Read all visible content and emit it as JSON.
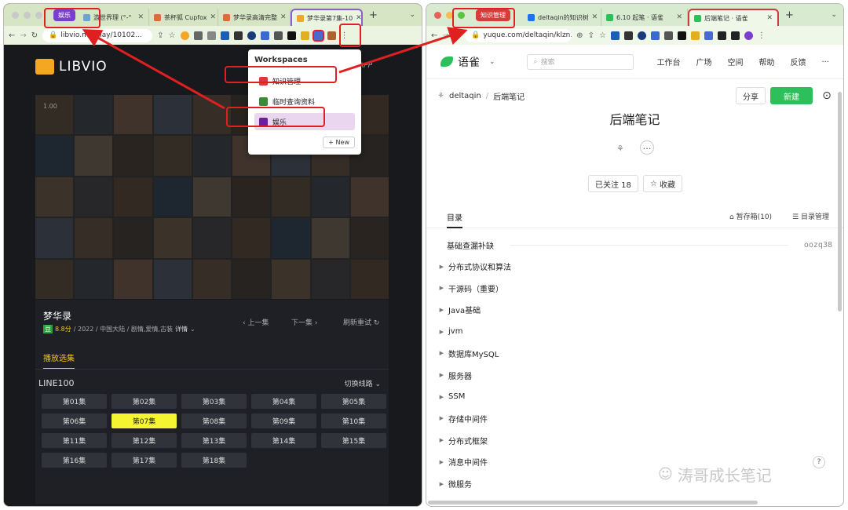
{
  "left": {
    "tabs": [
      {
        "label": "游世界理 (°-°",
        "fav": "#6aa3d8"
      },
      {
        "label": "茶杯狐 Cupfox",
        "fav": "#e06a3a"
      },
      {
        "label": "梦华录高清完整",
        "fav": "#e06a3a"
      },
      {
        "label": "梦华录第7集-10",
        "fav": "#f5a623"
      }
    ],
    "group": "娱乐",
    "url": "libvio.me/play/10102...",
    "logo": "LIBVIO",
    "app": "APP",
    "poster_label": "1.00",
    "show": {
      "title": "梦华录",
      "db": "豆",
      "score": "8.8分",
      "meta": "/ 2022 / 中国大陆 / 剧情,爱情,古装",
      "detail": "详情",
      "prev": "上一集",
      "next": "下一集",
      "refresh": "刷新重试"
    },
    "play_tab": "播放选集",
    "line": "LINE100",
    "switch": "切换线路",
    "episodes": [
      "第01集",
      "第02集",
      "第03集",
      "第04集",
      "第05集",
      "第06集",
      "第07集",
      "第08集",
      "第09集",
      "第10集",
      "第11集",
      "第12集",
      "第13集",
      "第14集",
      "第15集",
      "第16集",
      "第17集",
      "第18集"
    ],
    "current_episode": "第07集"
  },
  "workspaces": {
    "title": "Workspaces",
    "items": [
      {
        "label": "知识管理",
        "color": "#d93b3b"
      },
      {
        "label": "临时查询资料",
        "color": "#3a8a3a"
      },
      {
        "label": "娱乐",
        "color": "#6b1fa0"
      }
    ],
    "new": "New",
    "selected": "娱乐"
  },
  "right": {
    "group": "知识管理",
    "tabs": [
      {
        "label": "deltaqin的知识树",
        "fav": "#1a73e8"
      },
      {
        "label": "6.10 起笔 · 语雀",
        "fav": "#2dbf5a"
      },
      {
        "label": "后端笔记 · 语雀",
        "fav": "#2dbf5a"
      }
    ],
    "url": "yuque.com/deltaqin/klzn...",
    "brand": "语雀",
    "search": "搜索",
    "nav": [
      "工作台",
      "广场",
      "空间",
      "帮助",
      "反馈",
      "..."
    ],
    "crumb_user": "deltaqin",
    "crumb_book": "后端笔记",
    "share": "分享",
    "new": "新建",
    "book_title": "后端笔记",
    "followed": "已关注 18",
    "collect": "收藏",
    "toc_tab": "目录",
    "drafts": "暂存箱(10)",
    "toc_manage": "目录管理",
    "first_item": "基础查漏补缺",
    "first_item_code": "oozq38",
    "toc": [
      "分布式协议和算法",
      "干源码（重要）",
      "Java基础",
      "jvm",
      "数据库MySQL",
      "服务器",
      "SSM",
      "存储中间件",
      "分布式框架",
      "消息中间件",
      "微服务"
    ]
  },
  "watermark": "涛哥成长笔记",
  "colors": {
    "accent_yellow": "#f5f531",
    "annotation_red": "#e02020",
    "yuque_green": "#2dbf5a"
  }
}
